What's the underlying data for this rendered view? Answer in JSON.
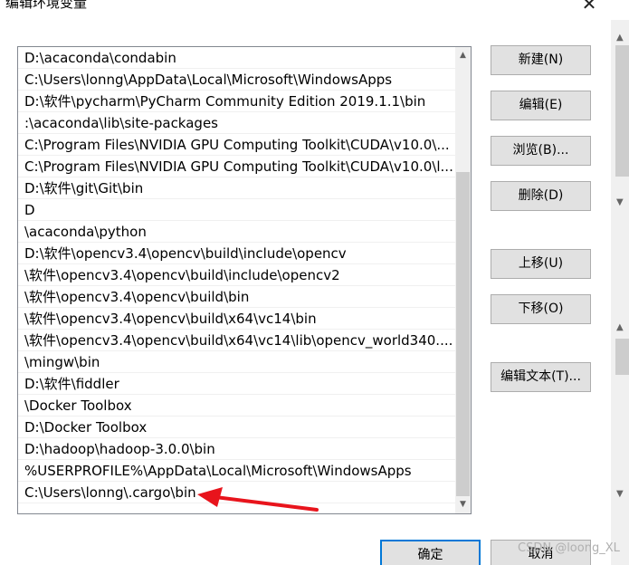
{
  "window": {
    "title": "编辑环境变量",
    "close_glyph": "✕"
  },
  "path_list": {
    "items": [
      "D:\\acaconda\\condabin",
      "C:\\Users\\lonng\\AppData\\Local\\Microsoft\\WindowsApps",
      "D:\\软件\\pycharm\\PyCharm Community Edition 2019.1.1\\bin",
      ":\\acaconda\\lib\\site-packages",
      "C:\\Program Files\\NVIDIA GPU Computing Toolkit\\CUDA\\v10.0\\...",
      "C:\\Program Files\\NVIDIA GPU Computing Toolkit\\CUDA\\v10.0\\l...",
      "D:\\软件\\git\\Git\\bin",
      "D",
      "\\acaconda\\python",
      "D:\\软件\\opencv3.4\\opencv\\build\\include\\opencv",
      "\\软件\\opencv3.4\\opencv\\build\\include\\opencv2",
      "\\软件\\opencv3.4\\opencv\\build\\bin",
      "\\软件\\opencv3.4\\opencv\\build\\x64\\vc14\\bin",
      "\\软件\\opencv3.4\\opencv\\build\\x64\\vc14\\lib\\opencv_world340....",
      "\\mingw\\bin",
      "D:\\软件\\fiddler",
      "\\Docker Toolbox",
      "D:\\Docker Toolbox",
      "D:\\hadoop\\hadoop-3.0.0\\bin",
      "%USERPROFILE%\\AppData\\Local\\Microsoft\\WindowsApps",
      "C:\\Users\\lonng\\.cargo\\bin"
    ]
  },
  "buttons": {
    "new": "新建(N)",
    "edit": "编辑(E)",
    "browse": "浏览(B)...",
    "delete": "删除(D)",
    "move_up": "上移(U)",
    "move_down": "下移(O)",
    "edit_text": "编辑文本(T)...",
    "ok": "确定",
    "cancel": "取消"
  },
  "watermark": "CSDN @loong_XL",
  "colors": {
    "annotation_arrow": "#e8141c",
    "ok_border": "#0078d7"
  }
}
